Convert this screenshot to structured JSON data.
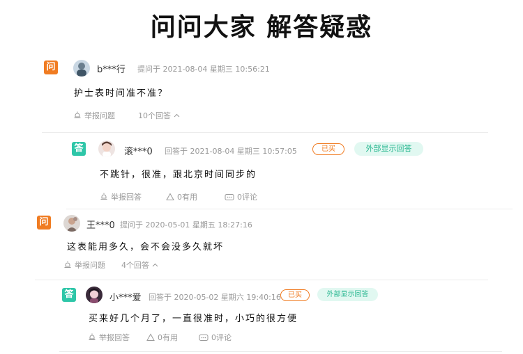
{
  "page": {
    "title": "问问大家 解答疑惑"
  },
  "badges": {
    "question": "问",
    "answer": "答"
  },
  "threads": [
    {
      "question": {
        "user": "b***行",
        "meta": "提问于 2021-08-04 星期三 10:56:21",
        "text": "护士表时间准不准？",
        "report_label": "举报问题",
        "answer_count": "10个回答"
      },
      "answer": {
        "user": "滚***0",
        "meta": "回答于 2021-08-04 星期三 10:57:05",
        "bought_tag": "已买",
        "external_tag": "外部显示回答",
        "text": "不跳针，很准，跟北京时间同步的",
        "report_label": "举报回答",
        "useful_label": "0有用",
        "comment_label": "0评论"
      }
    },
    {
      "question": {
        "user": "王***0",
        "meta": "提问于 2020-05-01 星期五 18:27:16",
        "text": "这表能用多久，会不会没多久就坏",
        "report_label": "举报问题",
        "answer_count": "4个回答"
      },
      "answer": {
        "user": "小***爱",
        "meta": "回答于 2020-05-02 星期六 19:40:16",
        "bought_tag": "已买",
        "external_tag": "外部显示回答",
        "text": "买来好几个月了，一直很准时，小巧的很方便",
        "report_label": "举报回答",
        "useful_label": "0有用",
        "comment_label": "0评论"
      }
    }
  ],
  "colors": {
    "question_badge": "#f07c22",
    "answer_badge": "#2ec6a8",
    "external_tag_bg": "#e1f8f1"
  },
  "icons": {
    "report": "alarm-bell-icon",
    "useful": "thumbs-up-icon",
    "comment": "comment-icon",
    "expand": "chevron-up-icon"
  }
}
